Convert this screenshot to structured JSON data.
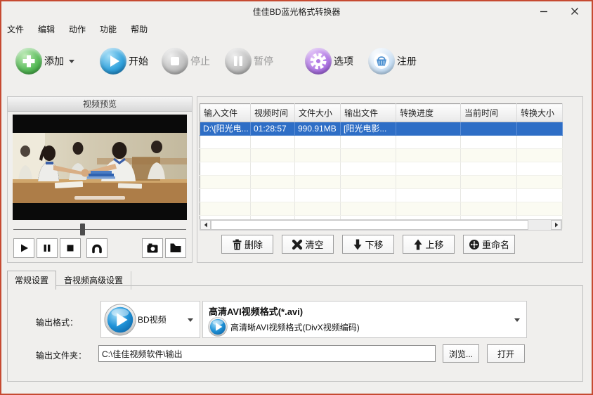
{
  "window": {
    "title": "佳佳BD蓝光格式转换器"
  },
  "menu": {
    "items": [
      "文件",
      "编辑",
      "动作",
      "功能",
      "帮助"
    ]
  },
  "toolbar": {
    "buttons": [
      {
        "label": "添加",
        "icon": "add-icon",
        "enabled": true,
        "has_dropdown": true
      },
      {
        "label": "开始",
        "icon": "start-icon",
        "enabled": true
      },
      {
        "label": "停止",
        "icon": "stop-icon",
        "enabled": false
      },
      {
        "label": "暂停",
        "icon": "pause-icon",
        "enabled": false
      },
      {
        "label": "选项",
        "icon": "options-icon",
        "enabled": true
      },
      {
        "label": "注册",
        "icon": "register-icon",
        "enabled": true
      }
    ]
  },
  "preview": {
    "title": "视频预览"
  },
  "table": {
    "headers": [
      "输入文件",
      "视频时间",
      "文件大小",
      "输出文件",
      "转换进度",
      "当前时间",
      "转换大小"
    ],
    "rows": [
      {
        "selected": true,
        "cells": [
          "D:\\[阳光电...",
          "01:28:57",
          "990.91MB",
          "[阳光电影...",
          "",
          "",
          ""
        ]
      }
    ],
    "empty_row_count": 7
  },
  "list_buttons": [
    {
      "label": "删除",
      "icon": "trash-icon"
    },
    {
      "label": "清空",
      "icon": "clear-x-icon"
    },
    {
      "label": "下移",
      "icon": "arrow-down-icon"
    },
    {
      "label": "上移",
      "icon": "arrow-up-icon"
    },
    {
      "label": "重命名",
      "icon": "rename-icon"
    }
  ],
  "tabs": [
    {
      "label": "常规设置",
      "active": true
    },
    {
      "label": "音视频高级设置",
      "active": false
    }
  ],
  "settings": {
    "format_label": "输出格式：",
    "format_primary": "BD视频",
    "format_secondary_title": "高清AVI视频格式(*.avi)",
    "format_secondary_value": "高清晰AVI视频格式(DivX视频编码)",
    "folder_label": "输出文件夹：",
    "folder_value": "C:\\佳佳视频软件\\输出",
    "browse_label": "浏览...",
    "open_label": "打开"
  },
  "colors": {
    "window_border": "#c64a31",
    "selected_row": "#2e6ec6",
    "add_green": "#3fa83f",
    "start_blue": "#1e9ad6",
    "options_purple": "#9a5ad2",
    "register_blue": "#4a8fd0"
  }
}
